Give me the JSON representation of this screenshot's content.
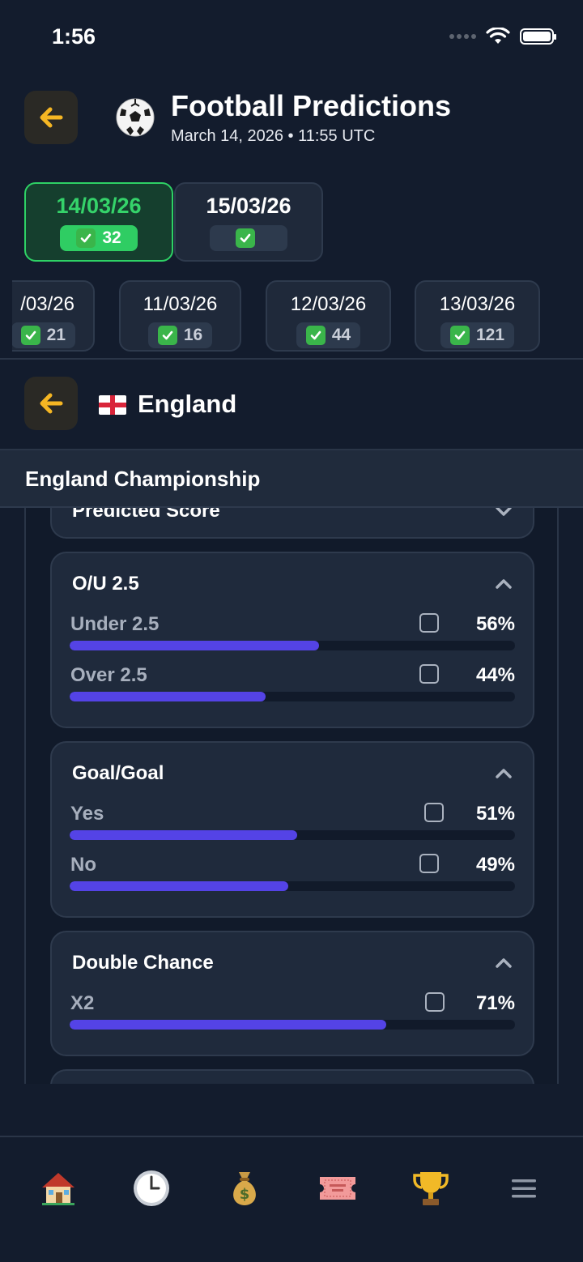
{
  "status_bar": {
    "time": "1:56"
  },
  "header": {
    "title": "Football Predictions",
    "subtitle": "March 14, 2026 • 11:55 UTC"
  },
  "date_tabs_primary": [
    {
      "label": "14/03/26",
      "count": "32",
      "active": true
    },
    {
      "label": "15/03/26",
      "count": "",
      "active": false
    }
  ],
  "date_tabs_secondary": [
    {
      "label": "/03/26",
      "count": "21"
    },
    {
      "label": "11/03/26",
      "count": "16"
    },
    {
      "label": "12/03/26",
      "count": "44"
    },
    {
      "label": "13/03/26",
      "count": "121"
    }
  ],
  "country": {
    "name": "England"
  },
  "league": {
    "name": "England Championship"
  },
  "markets": [
    {
      "title": "Predicted Score"
    },
    {
      "title": "O/U 2.5",
      "options": [
        {
          "label": "Under 2.5",
          "percent": "56%",
          "value": 56
        },
        {
          "label": "Over 2.5",
          "percent": "44%",
          "value": 44
        }
      ]
    },
    {
      "title": "Goal/Goal",
      "options": [
        {
          "label": "Yes",
          "percent": "51%",
          "value": 51
        },
        {
          "label": "No",
          "percent": "49%",
          "value": 49
        }
      ]
    },
    {
      "title": "Double Chance",
      "options": [
        {
          "label": "X2",
          "percent": "71%",
          "value": 71
        }
      ]
    }
  ],
  "colors": {
    "accent": "#5443e6",
    "active_green": "#2fcd63",
    "back_arrow": "#f5b623"
  },
  "bottom_nav": [
    "home-icon",
    "clock-icon",
    "money-bag-icon",
    "ticket-icon",
    "trophy-icon",
    "menu-icon"
  ]
}
